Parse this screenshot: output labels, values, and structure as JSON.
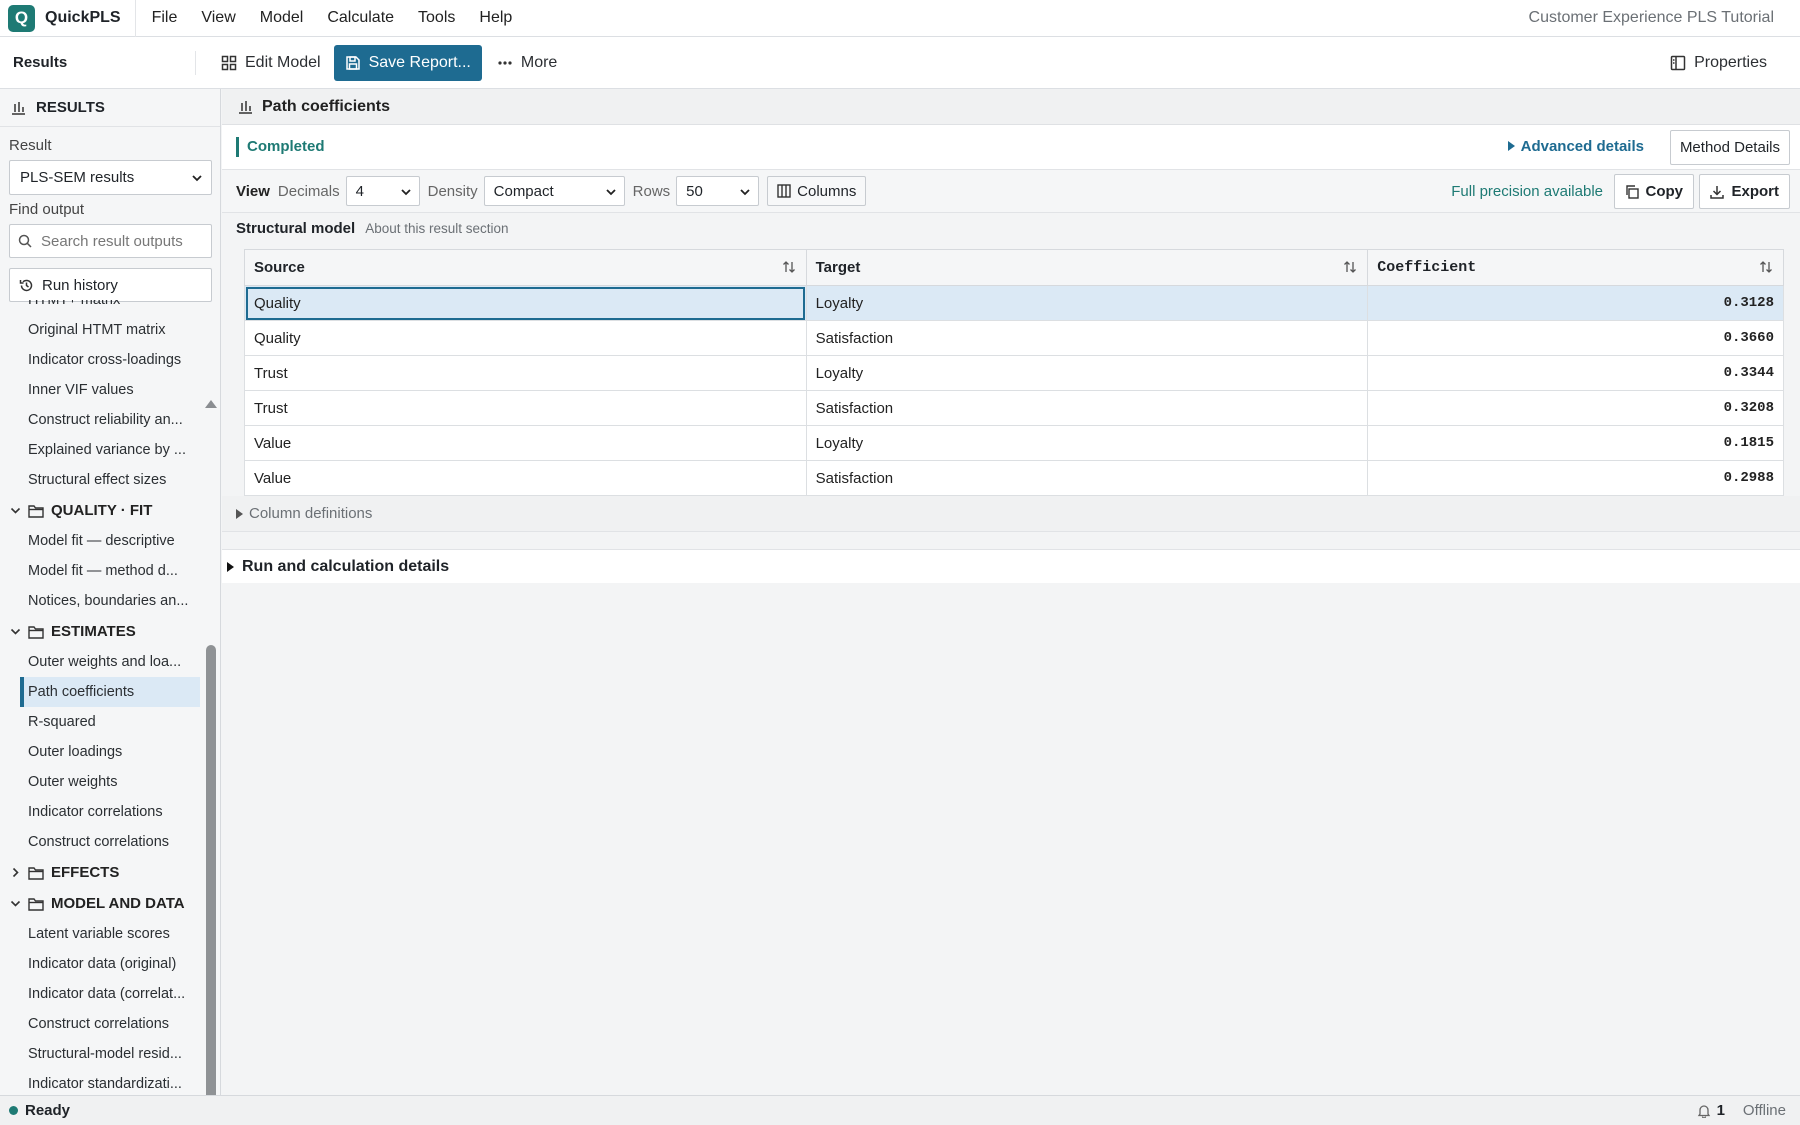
{
  "app": {
    "name": "QuickPLS",
    "logo_letter": "Q",
    "document_title": "Customer Experience PLS Tutorial"
  },
  "menu": [
    "File",
    "View",
    "Model",
    "Calculate",
    "Tools",
    "Help"
  ],
  "toolbar": {
    "section_label": "Results",
    "edit_model": "Edit Model",
    "save_report": "Save Report...",
    "more": "More",
    "properties": "Properties"
  },
  "sidebar": {
    "header": "RESULTS",
    "result_label": "Result",
    "result_value": "PLS-SEM results",
    "find_label": "Find output",
    "search_placeholder": "Search result outputs",
    "run_history": "Run history",
    "tree": [
      {
        "type": "item",
        "label": "HTMT+ matrix"
      },
      {
        "type": "item",
        "label": "Original HTMT matrix"
      },
      {
        "type": "item",
        "label": "Indicator cross-loadings"
      },
      {
        "type": "item",
        "label": "Inner VIF values"
      },
      {
        "type": "item",
        "label": "Construct reliability an..."
      },
      {
        "type": "item",
        "label": "Explained variance by ..."
      },
      {
        "type": "item",
        "label": "Structural effect sizes"
      },
      {
        "type": "group",
        "label": "QUALITY · FIT",
        "expanded": true
      },
      {
        "type": "item",
        "label": "Model fit — descriptive"
      },
      {
        "type": "item",
        "label": "Model fit — method d..."
      },
      {
        "type": "item",
        "label": "Notices, boundaries an..."
      },
      {
        "type": "group",
        "label": "ESTIMATES",
        "expanded": true
      },
      {
        "type": "item",
        "label": "Outer weights and loa..."
      },
      {
        "type": "item",
        "label": "Path coefficients",
        "active": true
      },
      {
        "type": "item",
        "label": "R-squared"
      },
      {
        "type": "item",
        "label": "Outer loadings"
      },
      {
        "type": "item",
        "label": "Outer weights"
      },
      {
        "type": "item",
        "label": "Indicator correlations"
      },
      {
        "type": "item",
        "label": "Construct correlations"
      },
      {
        "type": "group",
        "label": "EFFECTS",
        "expanded": false
      },
      {
        "type": "group",
        "label": "MODEL AND DATA",
        "expanded": true
      },
      {
        "type": "item",
        "label": "Latent variable scores"
      },
      {
        "type": "item",
        "label": "Indicator data (original)"
      },
      {
        "type": "item",
        "label": "Indicator data (correlat..."
      },
      {
        "type": "item",
        "label": "Construct correlations"
      },
      {
        "type": "item",
        "label": "Structural-model resid..."
      },
      {
        "type": "item",
        "label": "Indicator standardizati..."
      }
    ]
  },
  "panel": {
    "title": "Path coefficients",
    "status": "Completed",
    "advanced": "Advanced details",
    "method_details": "Method Details",
    "view_label": "View",
    "decimals_label": "Decimals",
    "decimals_value": "4",
    "density_label": "Density",
    "density_value": "Compact",
    "rows_label": "Rows",
    "rows_value": "50",
    "columns_btn": "Columns",
    "precision": "Full precision available",
    "copy": "Copy",
    "export": "Export",
    "section_title": "Structural model",
    "section_about": "About this result section",
    "column_definitions": "Column definitions",
    "run_details": "Run and calculation details"
  },
  "table": {
    "headers": [
      "Source",
      "Target",
      "Coefficient"
    ],
    "rows": [
      [
        "Quality",
        "Loyalty",
        "0.3128"
      ],
      [
        "Quality",
        "Satisfaction",
        "0.3660"
      ],
      [
        "Trust",
        "Loyalty",
        "0.3344"
      ],
      [
        "Trust",
        "Satisfaction",
        "0.3208"
      ],
      [
        "Value",
        "Loyalty",
        "0.1815"
      ],
      [
        "Value",
        "Satisfaction",
        "0.2988"
      ]
    ]
  },
  "statusbar": {
    "state": "Ready",
    "notifications": "1",
    "connection": "Offline"
  },
  "colors": {
    "accent": "#1e6b91",
    "teal": "#1e7a74",
    "selection": "#dbe9f5"
  }
}
